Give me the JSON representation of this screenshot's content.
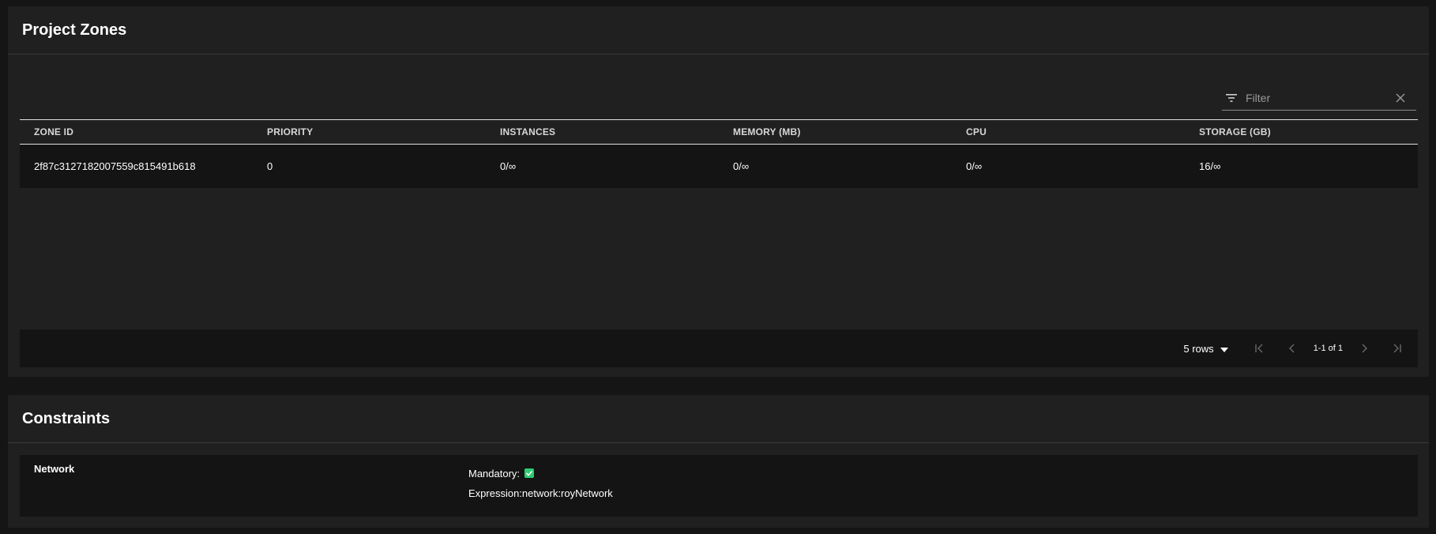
{
  "zones": {
    "title": "Project Zones",
    "filter": {
      "placeholder": "Filter"
    },
    "columns": [
      "ZONE ID",
      "PRIORITY",
      "INSTANCES",
      "MEMORY (MB)",
      "CPU",
      "STORAGE (GB)"
    ],
    "rows": [
      [
        "2f87c3127182007559c815491b618",
        "0",
        "0/∞",
        "0/∞",
        "0/∞",
        "16/∞"
      ]
    ],
    "pagination": {
      "rows_label": "5 rows",
      "range_label": "1-1 of 1"
    }
  },
  "constraints": {
    "title": "Constraints",
    "items": [
      {
        "name": "Network",
        "mandatory_label": "Mandatory:",
        "mandatory": true,
        "expression_label": "Expression:network:royNetwork"
      }
    ]
  },
  "colors": {
    "background": "#151515",
    "card": "#202020",
    "row": "#141414",
    "check": "#2ecc71"
  }
}
